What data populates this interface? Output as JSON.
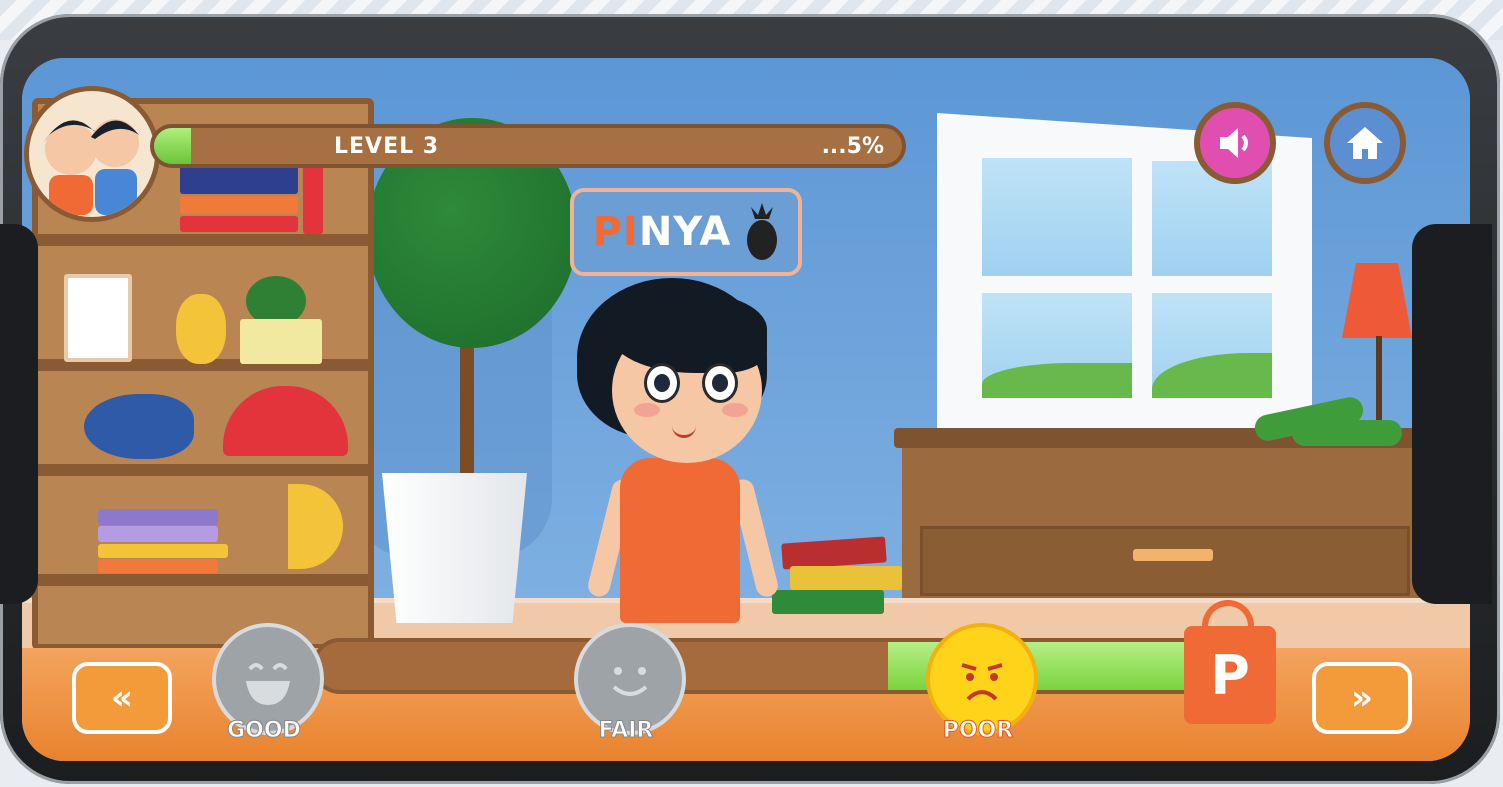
{
  "hud": {
    "level_label": "LEVEL 3",
    "progress_text": "...5%",
    "progress_fraction": 0.05,
    "sound_icon": "speaker-icon",
    "home_icon": "home-icon"
  },
  "word_card": {
    "highlight": "PI",
    "rest": "NYA",
    "icon": "pineapple-icon"
  },
  "navigation": {
    "prev_label": "«",
    "next_label": "»"
  },
  "rating": {
    "options": [
      {
        "label": "GOOD",
        "icon": "laughing-face-icon",
        "active": false
      },
      {
        "label": "FAIR",
        "icon": "smiling-face-icon",
        "active": false
      },
      {
        "label": "POOR",
        "icon": "sad-face-icon",
        "active": true
      }
    ]
  },
  "reward": {
    "bag_letter": "P",
    "icon": "shopping-bag-icon"
  },
  "colors": {
    "accent_orange": "#ef6a35",
    "progress_green": "#7bd23f",
    "wood_brown": "#8a5a33",
    "sound_button": "#e04fb0",
    "home_button": "#5b8fd1"
  }
}
